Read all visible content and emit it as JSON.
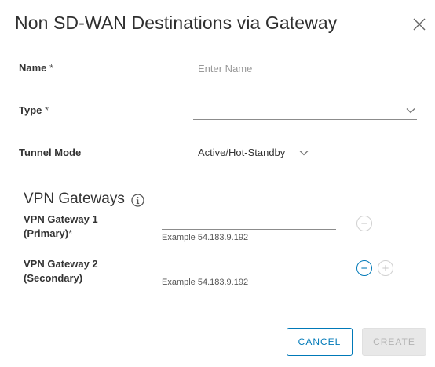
{
  "dialog": {
    "title": "Non SD-WAN Destinations via Gateway"
  },
  "form": {
    "name_label": "Name",
    "name_placeholder": "Enter Name",
    "name_value": "",
    "type_label": "Type",
    "type_value": "",
    "tunnel_mode_label": "Tunnel Mode",
    "tunnel_mode_value": "Active/Hot-Standby",
    "required_mark": "*"
  },
  "vpn": {
    "section_title": "VPN Gateways",
    "gateway1": {
      "label_line1": "VPN Gateway 1",
      "label_line2": "(Primary)",
      "required_mark": "*",
      "value": "",
      "hint": "Example 54.183.9.192"
    },
    "gateway2": {
      "label_line1": "VPN Gateway 2",
      "label_line2": "(Secondary)",
      "value": "",
      "hint": "Example 54.183.9.192"
    },
    "remove_glyph": "−",
    "add_glyph": "+"
  },
  "buttons": {
    "cancel": "CANCEL",
    "create": "CREATE"
  },
  "icons": {
    "close": "close-icon",
    "info": "info-icon",
    "chevron": "chevron-down-icon"
  },
  "colors": {
    "accent": "#0079b8",
    "disabled_bg": "#e8e8e8",
    "disabled_text": "#b3b3b3"
  }
}
